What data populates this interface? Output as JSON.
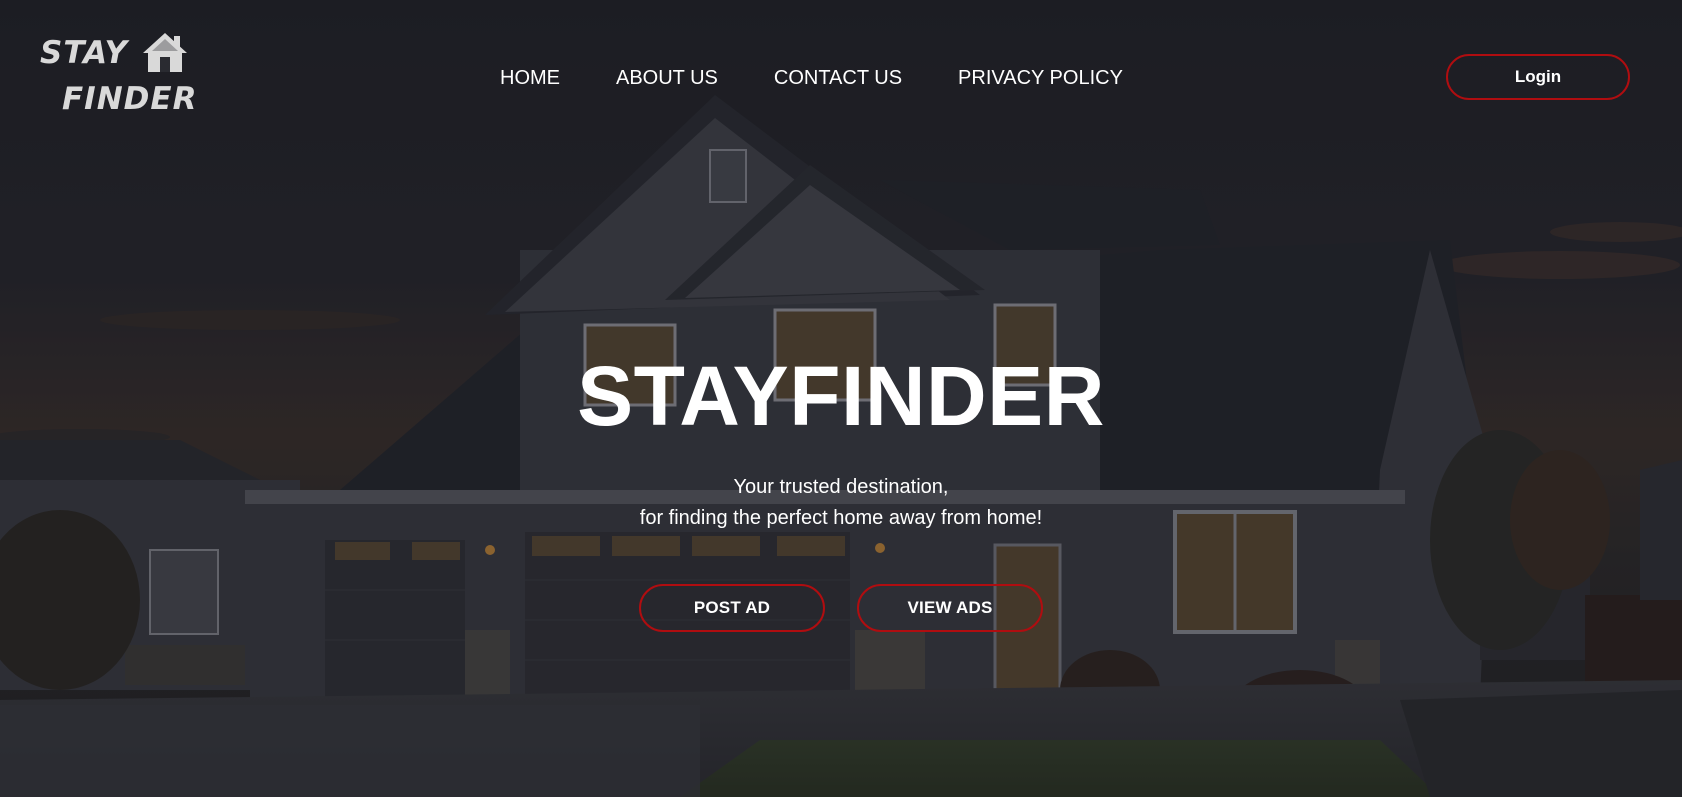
{
  "logo": {
    "line1": "STAY",
    "line2": "FINDER",
    "icon": "house-icon"
  },
  "nav": {
    "items": [
      {
        "label": "HOME"
      },
      {
        "label": "ABOUT US"
      },
      {
        "label": "CONTACT US"
      },
      {
        "label": "PRIVACY POLICY"
      }
    ]
  },
  "header": {
    "login_label": "Login"
  },
  "hero": {
    "title": "STAYFINDER",
    "subtitle_line1": "Your trusted destination,",
    "subtitle_line2": "for finding the perfect home away from home!",
    "post_ad_label": "POST AD",
    "view_ads_label": "VIEW ADS"
  },
  "colors": {
    "accent_border": "#b00d10",
    "text": "#ffffff",
    "logo": "#d9d9d9"
  }
}
